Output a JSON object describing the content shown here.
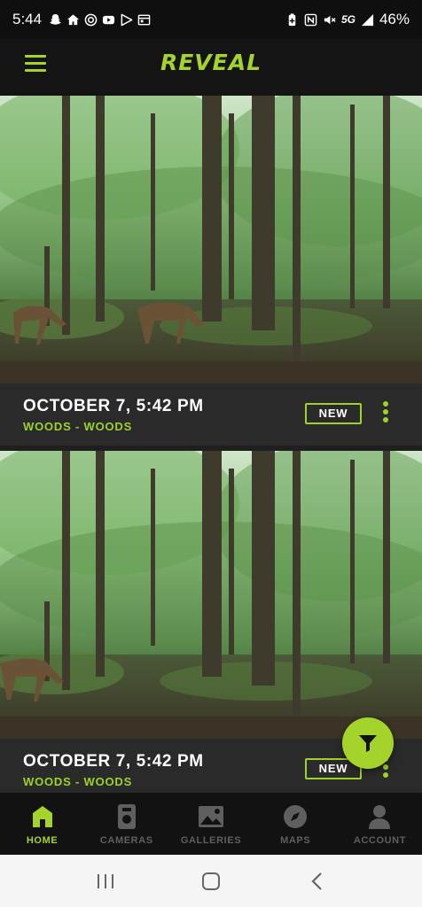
{
  "status": {
    "time": "5:44",
    "network": "5G",
    "battery": "46%",
    "left_icons": [
      "snapchat-icon",
      "home-icon",
      "target-icon",
      "youtube-icon",
      "play-store-icon",
      "calendar-icon"
    ],
    "right_icons": [
      "battery-saver-icon",
      "nfc-icon",
      "mute-icon",
      "signal-icon"
    ]
  },
  "header": {
    "brand": "REVEAL",
    "menu_icon": "hamburger-icon"
  },
  "photos": [
    {
      "date": "OCTOBER 7, 5:42 PM",
      "location": "WOODS - WOODS",
      "badge": "NEW"
    },
    {
      "date": "OCTOBER 7, 5:42 PM",
      "location": "WOODS - WOODS",
      "badge": "NEW"
    }
  ],
  "fab": {
    "icon": "filter-icon"
  },
  "bottom_nav": [
    {
      "label": "HOME",
      "icon": "home-icon",
      "active": true
    },
    {
      "label": "CAMERAS",
      "icon": "camera-icon",
      "active": false
    },
    {
      "label": "GALLERIES",
      "icon": "gallery-icon",
      "active": false
    },
    {
      "label": "MAPS",
      "icon": "compass-icon",
      "active": false
    },
    {
      "label": "ACCOUNT",
      "icon": "account-icon",
      "active": false
    }
  ],
  "system_nav": [
    "recents-icon",
    "home-circle-icon",
    "back-icon"
  ],
  "colors": {
    "accent": "#a4d42c",
    "background": "#141414",
    "caption_bg": "#2a2a2a"
  }
}
